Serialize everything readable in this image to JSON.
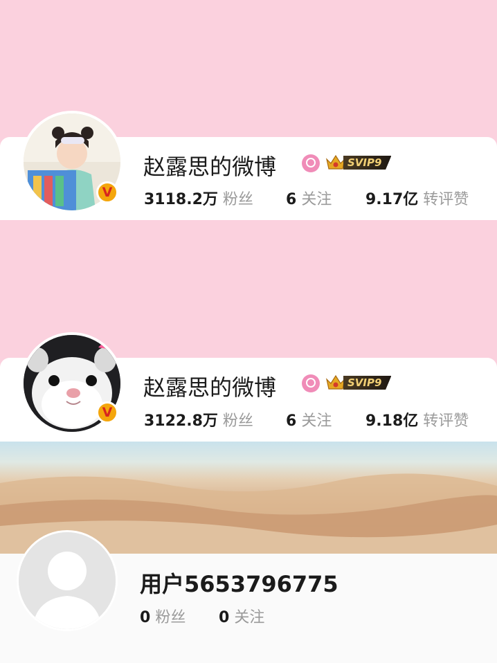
{
  "profiles": [
    {
      "name": "赵露思的微博",
      "svip_label": "SVIP9",
      "stats": [
        {
          "value": "3118.2万",
          "label": "粉丝"
        },
        {
          "value": "6",
          "label": "关注"
        },
        {
          "value": "9.17亿",
          "label": "转评赞"
        }
      ]
    },
    {
      "name": "赵露思的微博",
      "svip_label": "SVIP9",
      "stats": [
        {
          "value": "3122.8万",
          "label": "粉丝"
        },
        {
          "value": "6",
          "label": "关注"
        },
        {
          "value": "9.18亿",
          "label": "转评赞"
        }
      ]
    },
    {
      "name": "用户5653796775",
      "stats": [
        {
          "value": "0",
          "label": "粉丝"
        },
        {
          "value": "0",
          "label": "关注"
        }
      ]
    }
  ],
  "verified_badge_text": "V",
  "icons": {
    "verified": "verified-v-icon",
    "gender": "female-gender-icon",
    "crown": "crown-icon"
  },
  "colors": {
    "background": "#fbd1de",
    "card": "#ffffff",
    "verified_badge": "#f4a60c",
    "gender_badge": "#f08cb8"
  }
}
